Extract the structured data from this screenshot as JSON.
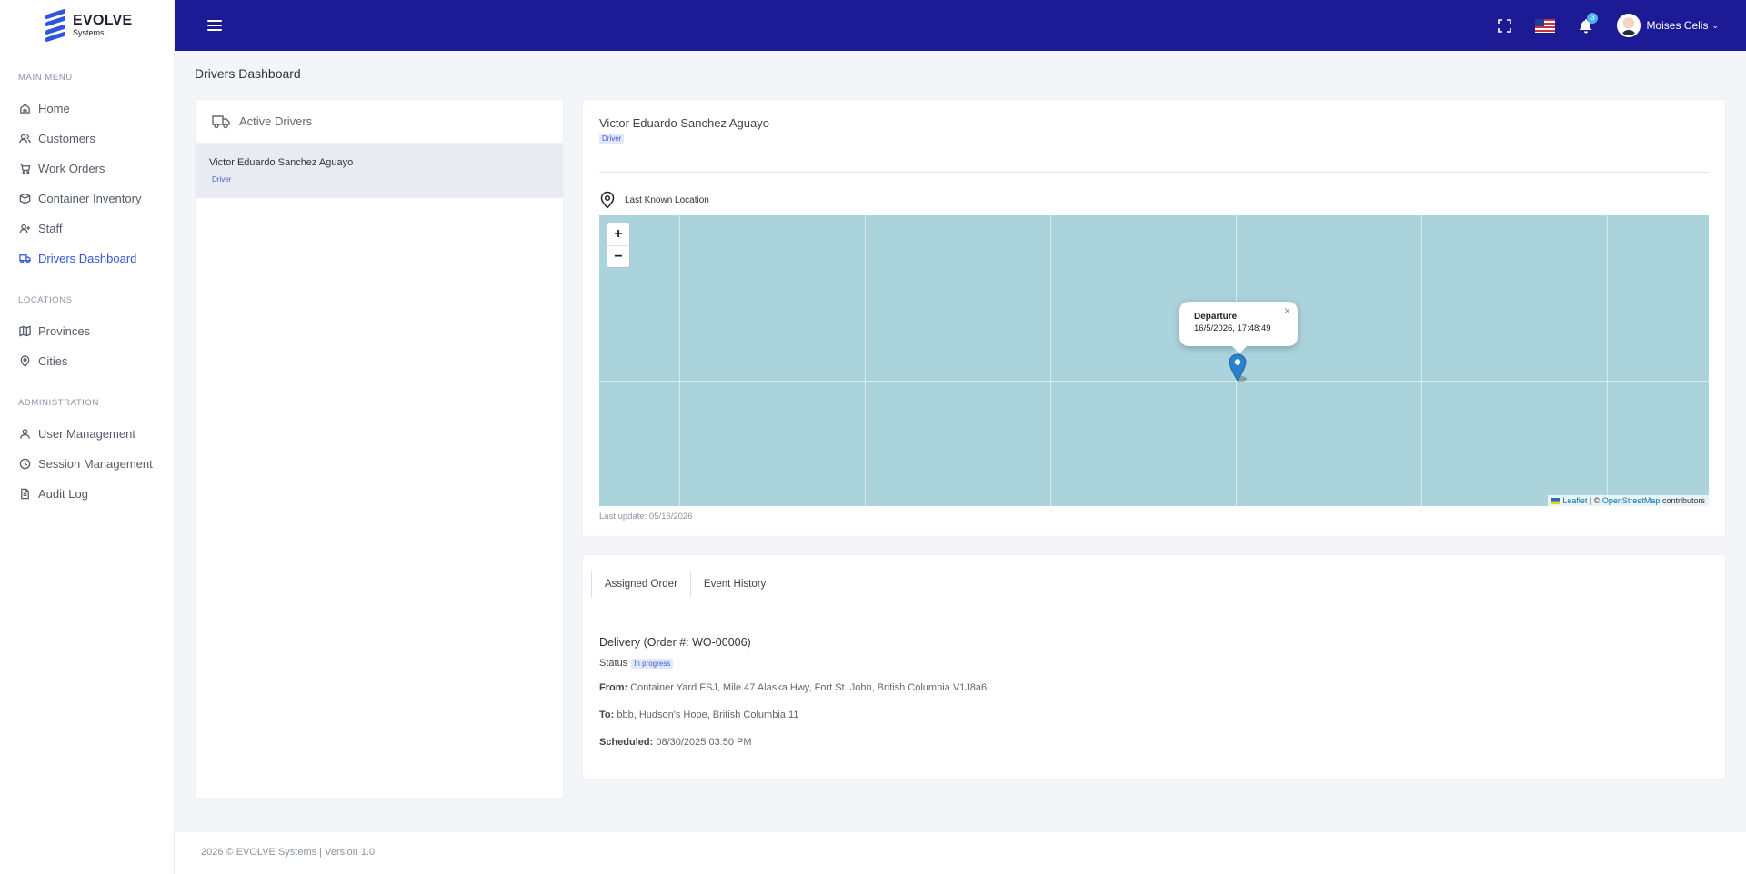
{
  "brand": {
    "line1": "EVOLVE",
    "line2": "Systems",
    "accent": "#2f56d8"
  },
  "topbar": {
    "color": "#1c1a94",
    "notification_count": "3",
    "user_name": "Moises Celis"
  },
  "sidebar": {
    "sections": [
      {
        "title": "MAIN MENU",
        "items": [
          {
            "label": "Home",
            "icon": "home-icon"
          },
          {
            "label": "Customers",
            "icon": "users-icon"
          },
          {
            "label": "Work Orders",
            "icon": "cart-icon"
          },
          {
            "label": "Container Inventory",
            "icon": "box-icon"
          },
          {
            "label": "Staff",
            "icon": "user-plus-icon"
          },
          {
            "label": "Drivers Dashboard",
            "icon": "truck-icon",
            "active": true
          }
        ]
      },
      {
        "title": "LOCATIONS",
        "items": [
          {
            "label": "Provinces",
            "icon": "map-icon"
          },
          {
            "label": "Cities",
            "icon": "map-pin-icon"
          }
        ]
      },
      {
        "title": "ADMINISTRATION",
        "items": [
          {
            "label": "User Management",
            "icon": "user-icon"
          },
          {
            "label": "Session Management",
            "icon": "clock-icon"
          },
          {
            "label": "Audit Log",
            "icon": "file-icon"
          }
        ]
      }
    ]
  },
  "page": {
    "title": "Drivers Dashboard"
  },
  "drivers_panel": {
    "title": "Active Drivers",
    "drivers": [
      {
        "name": "Victor Eduardo Sanchez Aguayo",
        "role": "Driver"
      }
    ]
  },
  "driver_detail": {
    "name": "Victor Eduardo Sanchez Aguayo",
    "role": "Driver",
    "location_label": "Last Known Location",
    "map": {
      "zoom_in": "+",
      "zoom_out": "−",
      "popup_title": "Departure",
      "popup_time": "16/5/2026, 17:48:49",
      "attribution_leaflet": "Leaflet",
      "attribution_sep": "| ©",
      "attribution_osm": "OpenStreetMap",
      "attribution_tail": "contributors"
    },
    "last_update": "Last update: 05/16/2026"
  },
  "order": {
    "tabs": [
      {
        "label": "Assigned Order",
        "active": true
      },
      {
        "label": "Event History",
        "active": false
      }
    ],
    "title": "Delivery (Order #: WO-00006)",
    "status_label": "Status",
    "status_value": "In progress",
    "from_label": "From:",
    "from_value": "Container Yard FSJ, Mile 47 Alaska Hwy, Fort St. John, British Columbia V1J8a6",
    "to_label": "To:",
    "to_value": "bbb, Hudson's Hope, British Columbia 11",
    "scheduled_label": "Scheduled:",
    "scheduled_value": "08/30/2025 03:50 PM"
  },
  "footer": {
    "text": "2026 © EVOLVE Systems | Version 1.0"
  }
}
